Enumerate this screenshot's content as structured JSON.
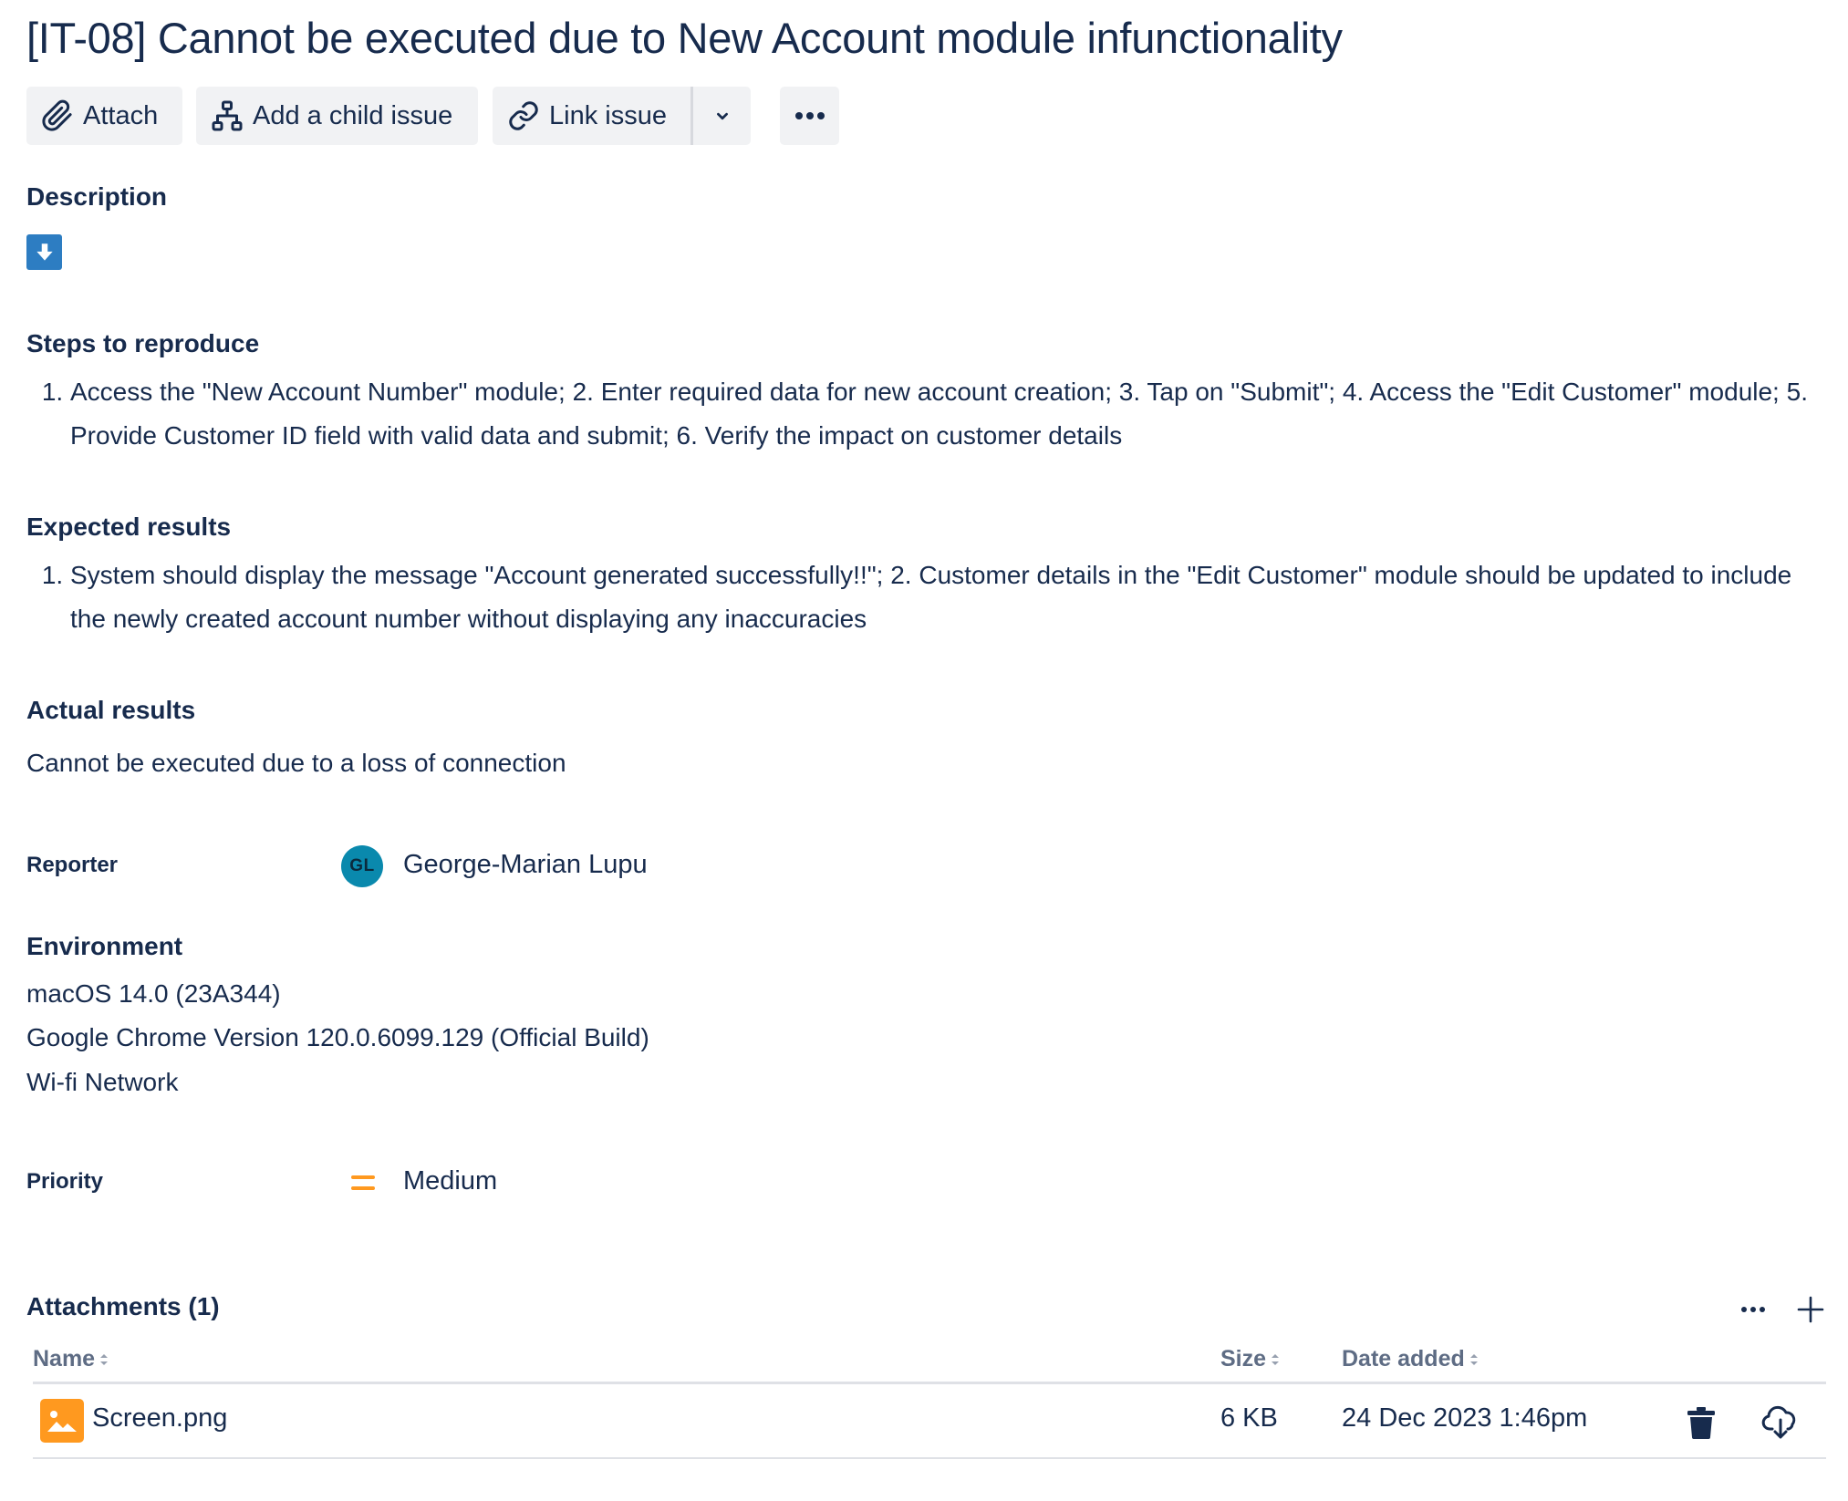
{
  "issue": {
    "title": "[IT-08] Cannot be executed due to New Account module infunctionality"
  },
  "toolbar": {
    "attach_label": "Attach",
    "add_child_label": "Add a child issue",
    "link_issue_label": "Link issue",
    "icons": [
      "paperclip-icon",
      "child-issue-icon",
      "link-icon",
      "chevron-down-icon",
      "more-icon"
    ]
  },
  "description": {
    "heading": "Description",
    "icon": "download-arrow-icon",
    "icon_color": "#2d7dc2"
  },
  "steps": {
    "heading": "Steps to reproduce",
    "items": [
      "Access the \"New Account Number\" module; 2. Enter required data for new account creation; 3. Tap on \"Submit\"; 4. Access the \"Edit Customer\" module; 5. Provide Customer ID field with valid data and submit; 6. Verify the impact on customer details"
    ]
  },
  "expected": {
    "heading": "Expected results",
    "items": [
      "System should display the message \"Account generated successfully!!\"; 2. Customer details in the \"Edit Customer\" module should be updated to include the newly created account number without displaying any inaccuracies"
    ]
  },
  "actual": {
    "heading": "Actual results",
    "text": "Cannot be executed due to a loss of connection"
  },
  "reporter": {
    "label": "Reporter",
    "initials": "GL",
    "name": "George-Marian Lupu",
    "avatar_color": "#0a89ad"
  },
  "environment": {
    "heading": "Environment",
    "lines": [
      "macOS 14.0 (23A344)",
      "Google Chrome Version 120.0.6099.129 (Official Build)",
      "Wi-fi Network"
    ]
  },
  "priority": {
    "label": "Priority",
    "value": "Medium",
    "icon": "priority-medium-icon",
    "icon_color": "#ff991f"
  },
  "attachments": {
    "heading": "Attachments (1)",
    "columns": [
      "Name",
      "Size",
      "Date added"
    ],
    "rows": [
      {
        "name": "Screen.png",
        "size": "6 KB",
        "date_added": "24 Dec 2023 1:46pm"
      }
    ],
    "icons": [
      "more-icon",
      "plus-icon",
      "image-file-icon",
      "trash-icon",
      "cloud-download-icon"
    ]
  },
  "colors": {
    "text": "#172b4d",
    "button_bg": "#f1f2f4",
    "muted": "#5e6c84"
  }
}
